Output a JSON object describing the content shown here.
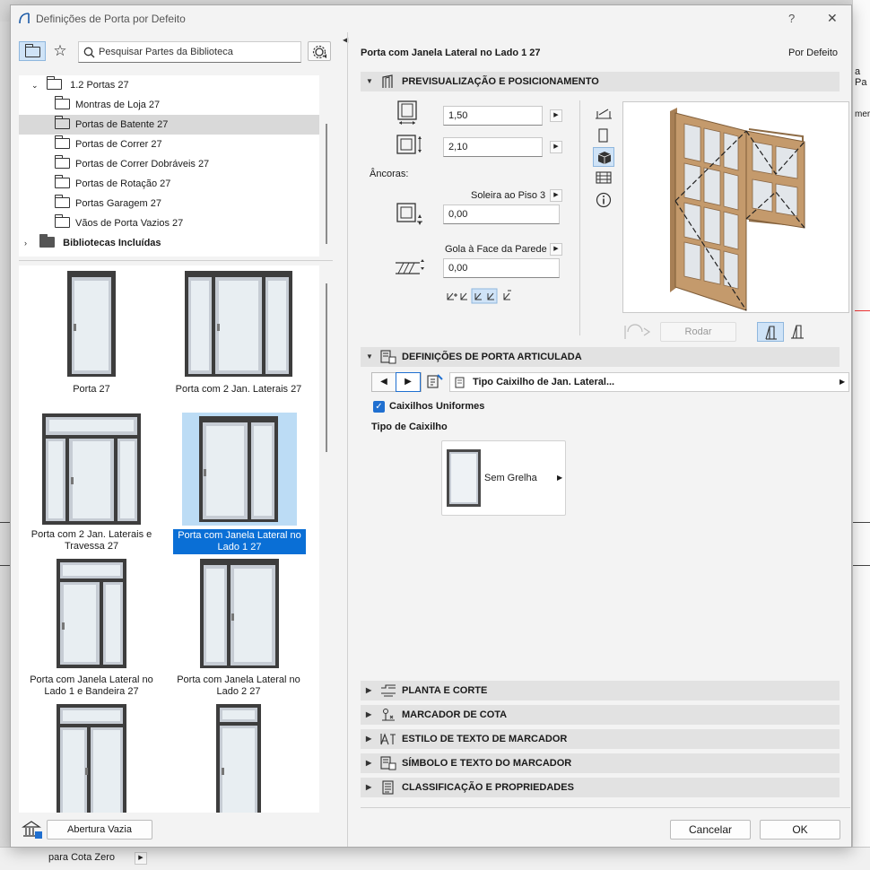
{
  "dialog": {
    "title": "Definições de Porta por Defeito",
    "help": "?",
    "close": "✕"
  },
  "search": {
    "placeholder": "Pesquisar Partes da Biblioteca"
  },
  "tree": {
    "root": "1.2 Portas 27",
    "items": [
      "Montras de Loja 27",
      "Portas de Batente 27",
      "Portas de Correr 27",
      "Portas de Correr Dobráveis 27",
      "Portas de Rotação 27",
      "Portas Garagem 27",
      "Vãos de Porta Vazios 27"
    ],
    "included": "Bibliotecas Incluídas"
  },
  "thumbnails": [
    "Porta 27",
    "Porta com 2 Jan. Laterais 27",
    "Porta com 2 Jan. Laterais e Travessa 27",
    "Porta com Janela Lateral no Lado 1 27",
    "Porta com Janela Lateral no Lado 1 e Bandeira 27",
    "Porta com Janela Lateral no Lado 2 27"
  ],
  "empty_opening": "Abertura Vazia",
  "header": {
    "name": "Porta com Janela Lateral no Lado 1 27",
    "default": "Por Defeito"
  },
  "preview_section": {
    "title": "PREVISUALIZAÇÃO E POSICIONAMENTO",
    "width": "1,50",
    "height": "2,10",
    "anchors": "Âncoras:",
    "sill_label": "Soleira ao Piso 3",
    "sill_value": "0,00",
    "reveal_label": "Gola à Face da Parede",
    "reveal_value": "0,00",
    "rotate": "Rodar"
  },
  "hinged_section": {
    "title": "DEFINIÇÕES DE PORTA ARTICULADA",
    "panel_type": "Tipo Caixilho de Jan. Lateral...",
    "uniform": "Caixilhos Uniformes",
    "sash_type_label": "Tipo de Caixilho",
    "sash_option": "Sem Grelha"
  },
  "sections": [
    "PLANTA E CORTE",
    "MARCADOR DE COTA",
    "ESTILO DE TEXTO DE MARCADOR",
    "SÍMBOLO E TEXTO DO MARCADOR",
    "CLASSIFICAÇÃO E PROPRIEDADES"
  ],
  "buttons": {
    "cancel": "Cancelar",
    "ok": "OK"
  },
  "background": {
    "status": "para Cota Zero",
    "side_fragment": "a Pa",
    "side_fragment2": "mer"
  },
  "colors": {
    "selected": "#0a6fd6",
    "selected_thumb_bg": "#bcdcf5",
    "wood": "#c49a6c"
  }
}
